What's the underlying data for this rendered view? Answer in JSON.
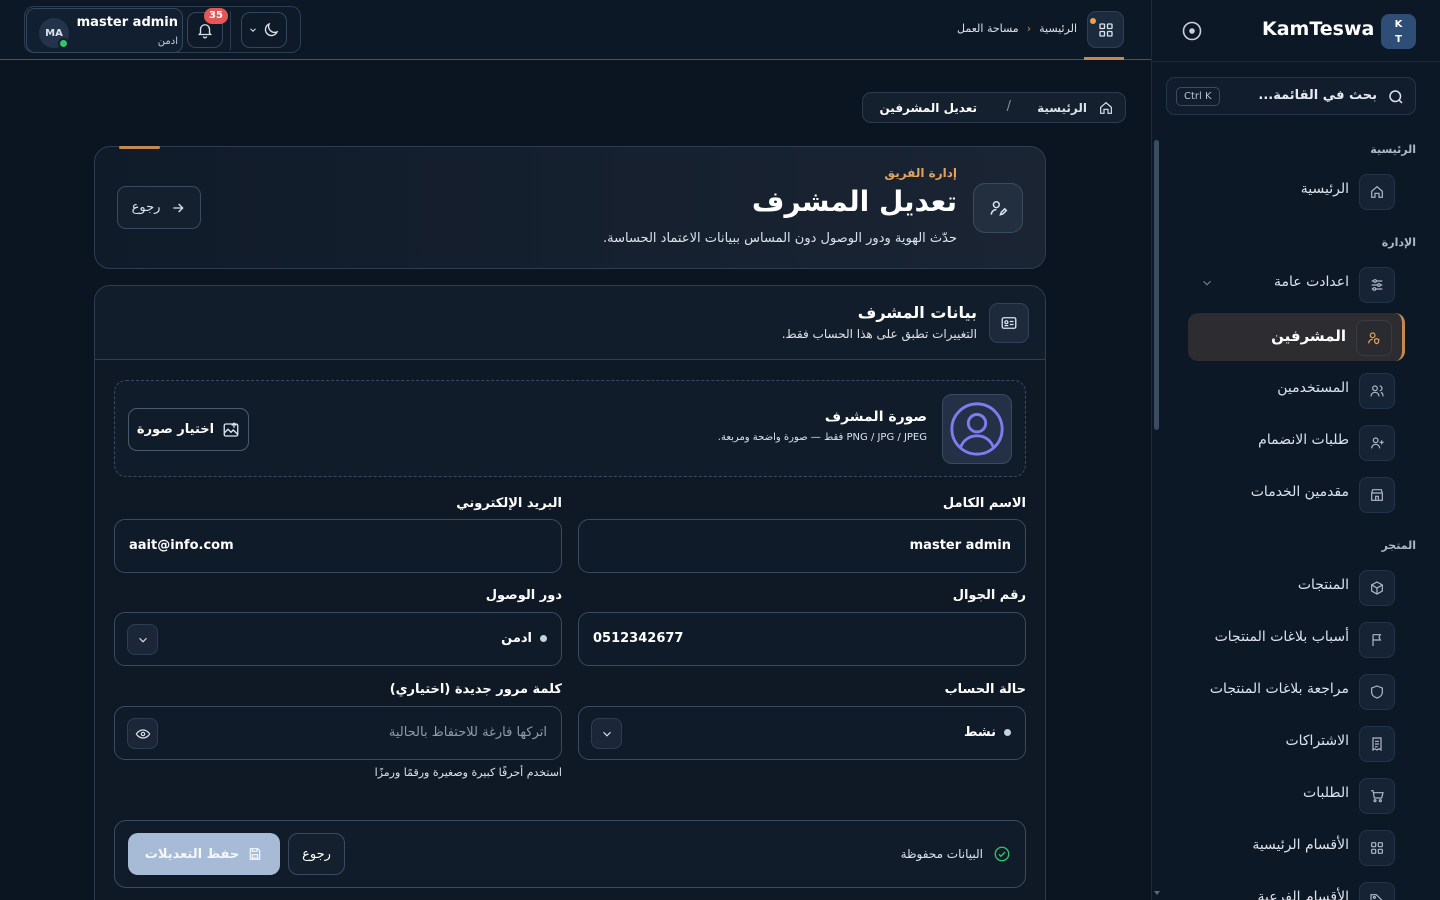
{
  "sidebar": {
    "brand_initials_top": "K",
    "brand_initials_bottom": "T",
    "brand_name": "KamTeswa",
    "search_placeholder": "بحث في القائمة...",
    "search_shortcut": "Ctrl K",
    "sections": {
      "home": "الرئيسية",
      "admin": "الإدارة",
      "store": "المتجر"
    },
    "items": [
      {
        "label": "الرئيسية",
        "icon": "home-icon"
      },
      {
        "label": "اعدادت عامة",
        "icon": "sliders-icon"
      },
      {
        "label": "المشرفين",
        "icon": "user-shield-icon"
      },
      {
        "label": "المستخدمين",
        "icon": "users-icon"
      },
      {
        "label": "طلبات الانضمام",
        "icon": "user-plus-icon"
      },
      {
        "label": "مقدمين الخدمات",
        "icon": "store-icon"
      },
      {
        "label": "المنتجات",
        "icon": "box-icon"
      },
      {
        "label": "أسباب بلاغات المنتجات",
        "icon": "flag-icon"
      },
      {
        "label": "مراجعة بلاغات المنتجات",
        "icon": "shield-icon"
      },
      {
        "label": "الاشتراكات",
        "icon": "receipt-icon"
      },
      {
        "label": "الطلبات",
        "icon": "cart-icon"
      },
      {
        "label": "الأقسام الرئيسية",
        "icon": "grid-icon"
      },
      {
        "label": "الأقسام الفرعية",
        "icon": "tag-icon"
      }
    ]
  },
  "topbar": {
    "crumb_home": "الرئيسية",
    "crumb_current": "مساحة العمل",
    "user_initials": "MA",
    "user_name": "master admin",
    "user_role": "ادمن",
    "notification_count": "35"
  },
  "breadcrumb": {
    "home": "الرئيسية",
    "current": "تعديل المشرفين"
  },
  "hero": {
    "eyebrow": "إدارة الفريق",
    "title": "تعديل المشرف",
    "subtitle": "حدّث الهوية ودور الوصول دون المساس ببيانات الاعتماد الحساسة.",
    "back_label": "رجوع"
  },
  "card": {
    "title": "بيانات المشرف",
    "subtitle": "التغييرات تطبق على هذا الحساب فقط.",
    "photo_title": "صورة المشرف",
    "photo_hint": "PNG / JPG / JPEG فقط — صورة واضحة ومربعة.",
    "photo_button": "اختيار صورة",
    "fields": {
      "full_name_label": "الاسم الكامل",
      "full_name_value": "master admin",
      "email_label": "البريد الإلكتروني",
      "email_value": "aait@info.com",
      "phone_label": "رقم الجوال",
      "phone_value": "0512342677",
      "role_label": "دور الوصول",
      "role_value": "ادمن",
      "status_label": "حالة الحساب",
      "status_value": "نشط",
      "password_label": "كلمة مرور جديدة (اختياري)",
      "password_placeholder": "اتركها فارغة للاحتفاظ بالحالية",
      "password_hint": "استخدم أحرفًا كبيرة وصغيرة ورقمًا ورمزًا"
    },
    "footer": {
      "saved_status": "البيانات محفوظة",
      "back_label": "رجوع",
      "save_label": "حفظ التعديلات"
    }
  },
  "colors": {
    "accent": "#c3894d",
    "background": "#0b1522",
    "online": "#36c26a",
    "badge": "#e45757",
    "save_button": "#a8bbd6"
  }
}
